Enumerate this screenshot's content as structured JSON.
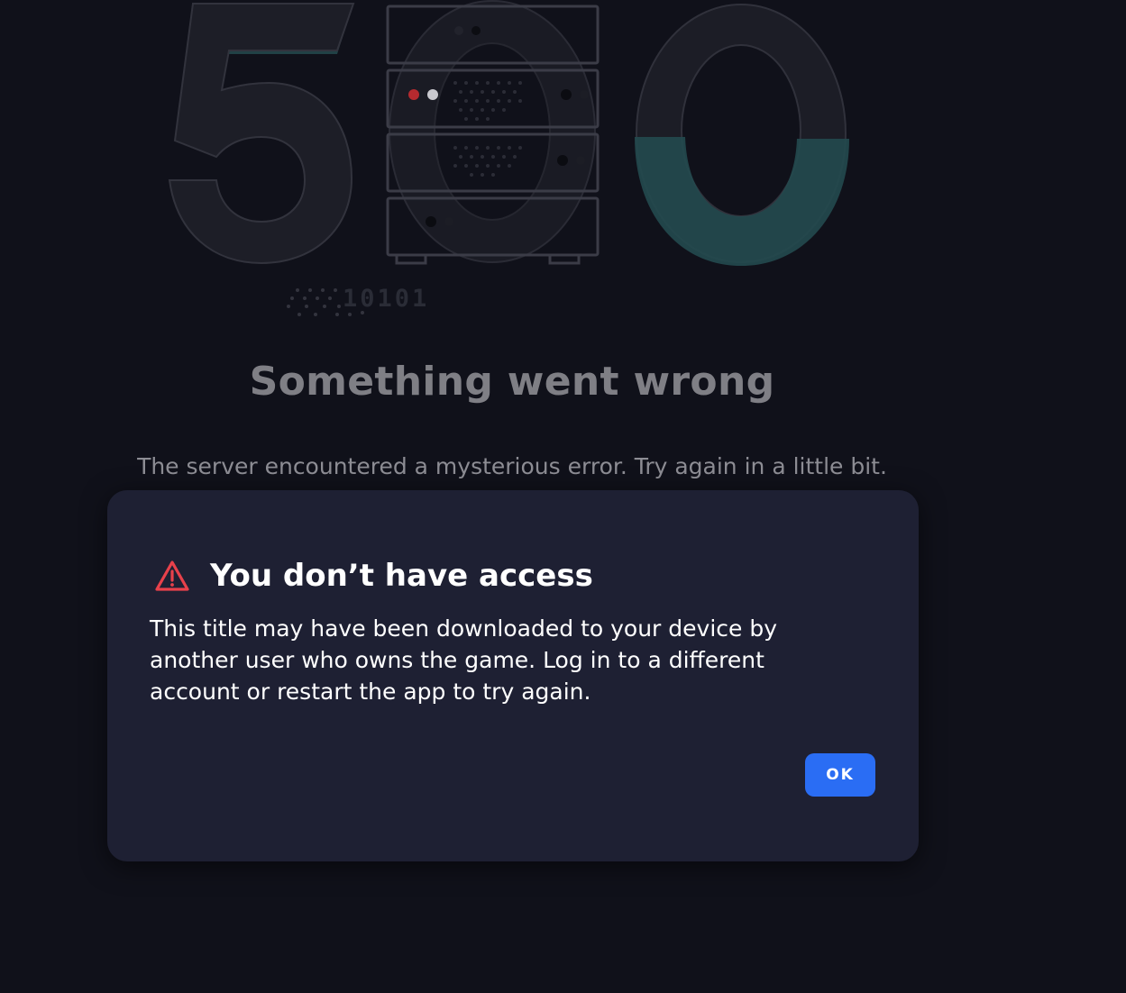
{
  "background": {
    "illustration_text": "10101",
    "title": "Something went wrong",
    "message": "The server encountered a mysterious error. Try again in a little bit."
  },
  "dialog": {
    "icon": "warning-triangle-icon",
    "title": "You don’t have access",
    "body": "This title may have been downloaded to your device by another user who owns the game. Log in to a different account or restart the app to try again.",
    "ok_label": "OK"
  },
  "colors": {
    "page_bg": "#10111a",
    "dialog_bg": "#1e2033",
    "accent": "#2a6df4",
    "warning": "#e8414b",
    "teal": "#244a4f"
  }
}
